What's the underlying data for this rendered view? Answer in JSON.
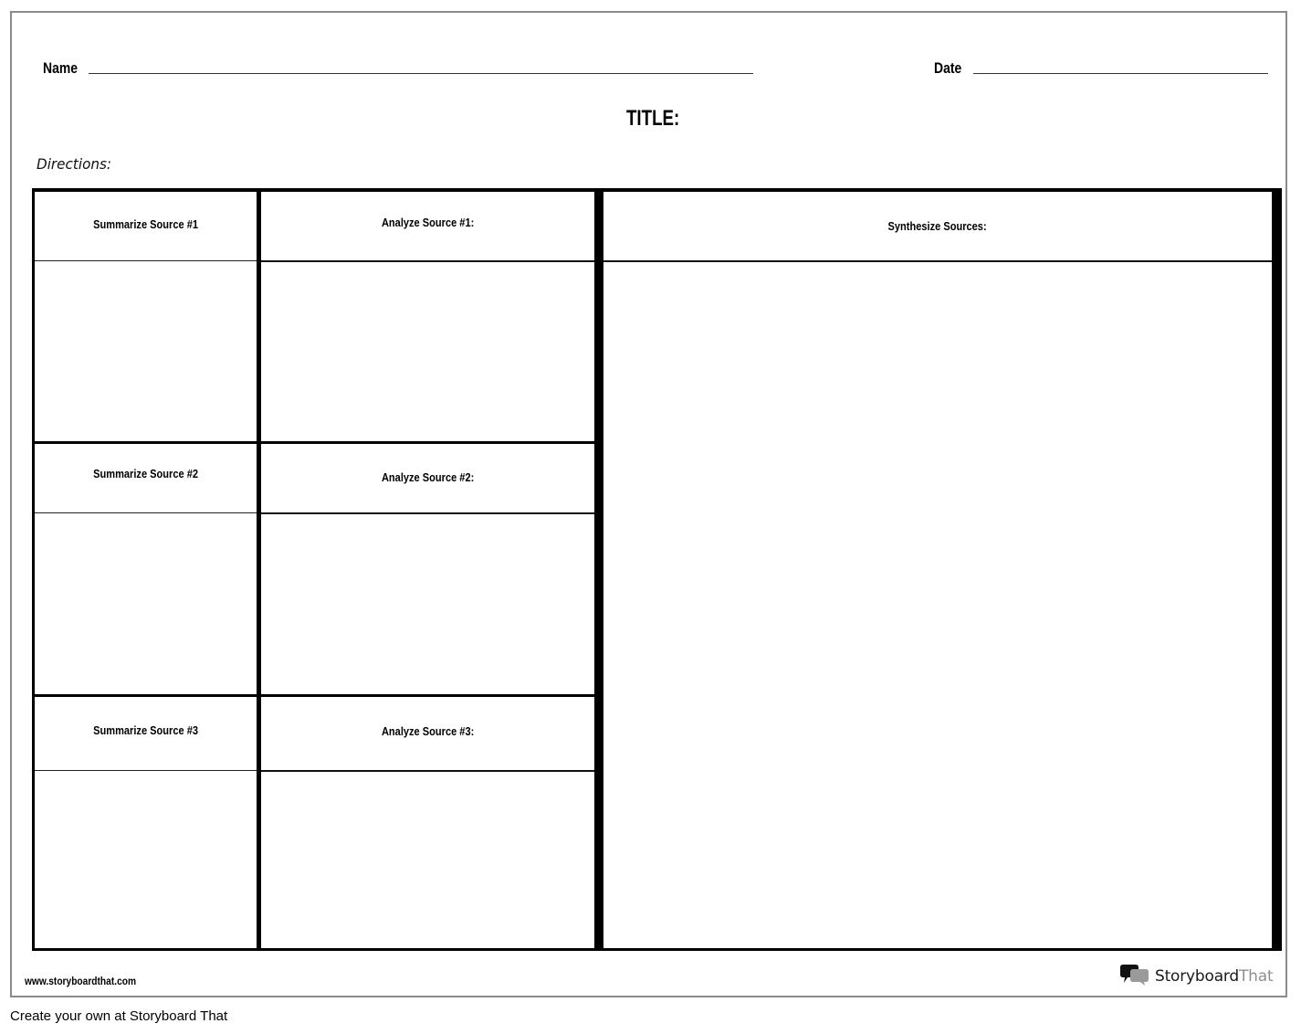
{
  "worksheet": {
    "name_label": "Name",
    "date_label": "Date",
    "title_label": "TITLE:",
    "directions_label": "Directions:"
  },
  "grid": {
    "summarize_headers": [
      "Summarize Source #1",
      "Summarize Source #2",
      "Summarize Source #3"
    ],
    "analyze_headers": [
      "Analyze Source #1:",
      "Analyze Source #2:",
      "Analyze Source #3:"
    ],
    "synthesize_header": "Synthesize Sources:"
  },
  "footer": {
    "url": "www.storyboardthat.com",
    "brand_primary": "Storyboard",
    "brand_secondary": "That",
    "brand_icon": "speech-bubbles-icon",
    "caption": "Create your own at Storyboard That"
  },
  "colors": {
    "border": "#000000",
    "sheet_border": "#8a8a8a",
    "brand_gray": "#8f8f8f"
  }
}
